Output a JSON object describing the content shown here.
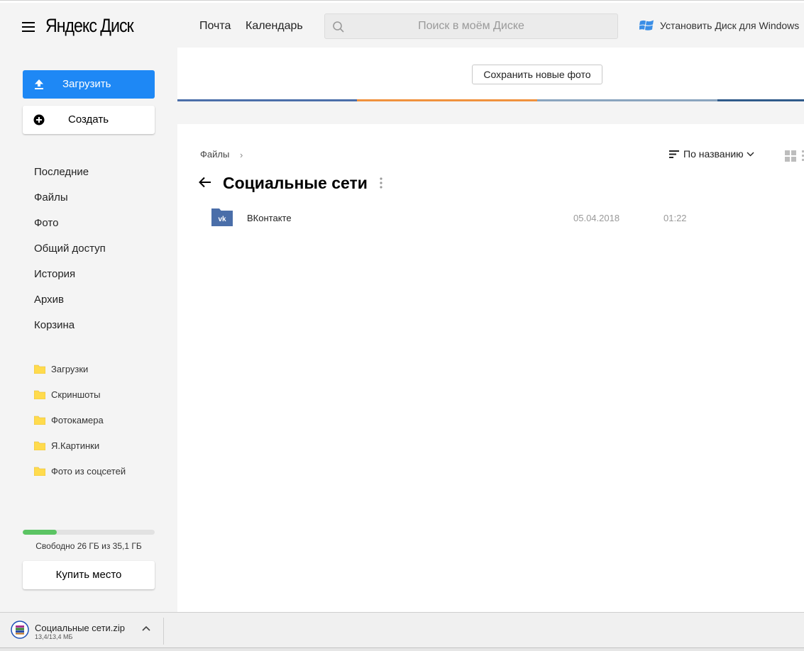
{
  "header": {
    "logo": "Яндекс Диск",
    "nav": [
      {
        "label": "Почта"
      },
      {
        "label": "Календарь"
      }
    ],
    "search_placeholder": "Поиск в моём Диске",
    "install_label": "Установить Диск для Windows",
    "install_icon": "windows-logo-icon"
  },
  "sidebar": {
    "upload_label": "Загрузить",
    "create_label": "Создать",
    "nav": [
      {
        "label": "Последние"
      },
      {
        "label": "Файлы"
      },
      {
        "label": "Фото"
      },
      {
        "label": "Общий доступ"
      },
      {
        "label": "История"
      },
      {
        "label": "Архив"
      },
      {
        "label": "Корзина"
      }
    ],
    "folders": [
      {
        "label": "Загрузки"
      },
      {
        "label": "Скриншоты"
      },
      {
        "label": "Фотокамера"
      },
      {
        "label": "Я.Картинки"
      },
      {
        "label": "Фото из соцсетей"
      }
    ],
    "storage": {
      "used_fraction": 0.26,
      "text": "Свободно 26 ГБ из 35,1 ГБ"
    },
    "buy_label": "Купить место"
  },
  "promo": {
    "save_photos_label": "Сохранить новые фото",
    "stripe_colors": [
      "#4a6ea9",
      "#f0913d",
      "#8aa4be",
      "#2f5a8a"
    ]
  },
  "content": {
    "breadcrumb": "Файлы",
    "breadcrumb_sep": "›",
    "sort_label": "По названию",
    "title": "Социальные сети",
    "files": [
      {
        "name": "ВКонтакте",
        "date": "05.04.2018",
        "time": "01:22",
        "icon": "vk-folder-icon"
      }
    ]
  },
  "downloads": {
    "file_name": "Социальные сети.zip",
    "progress": "13,4/13,4 МБ"
  },
  "colors": {
    "accent": "#1e88f5",
    "storage_fill": "#5bc463",
    "folder_yellow": "#ffdb4d",
    "vk_blue": "#4a6ea9"
  }
}
